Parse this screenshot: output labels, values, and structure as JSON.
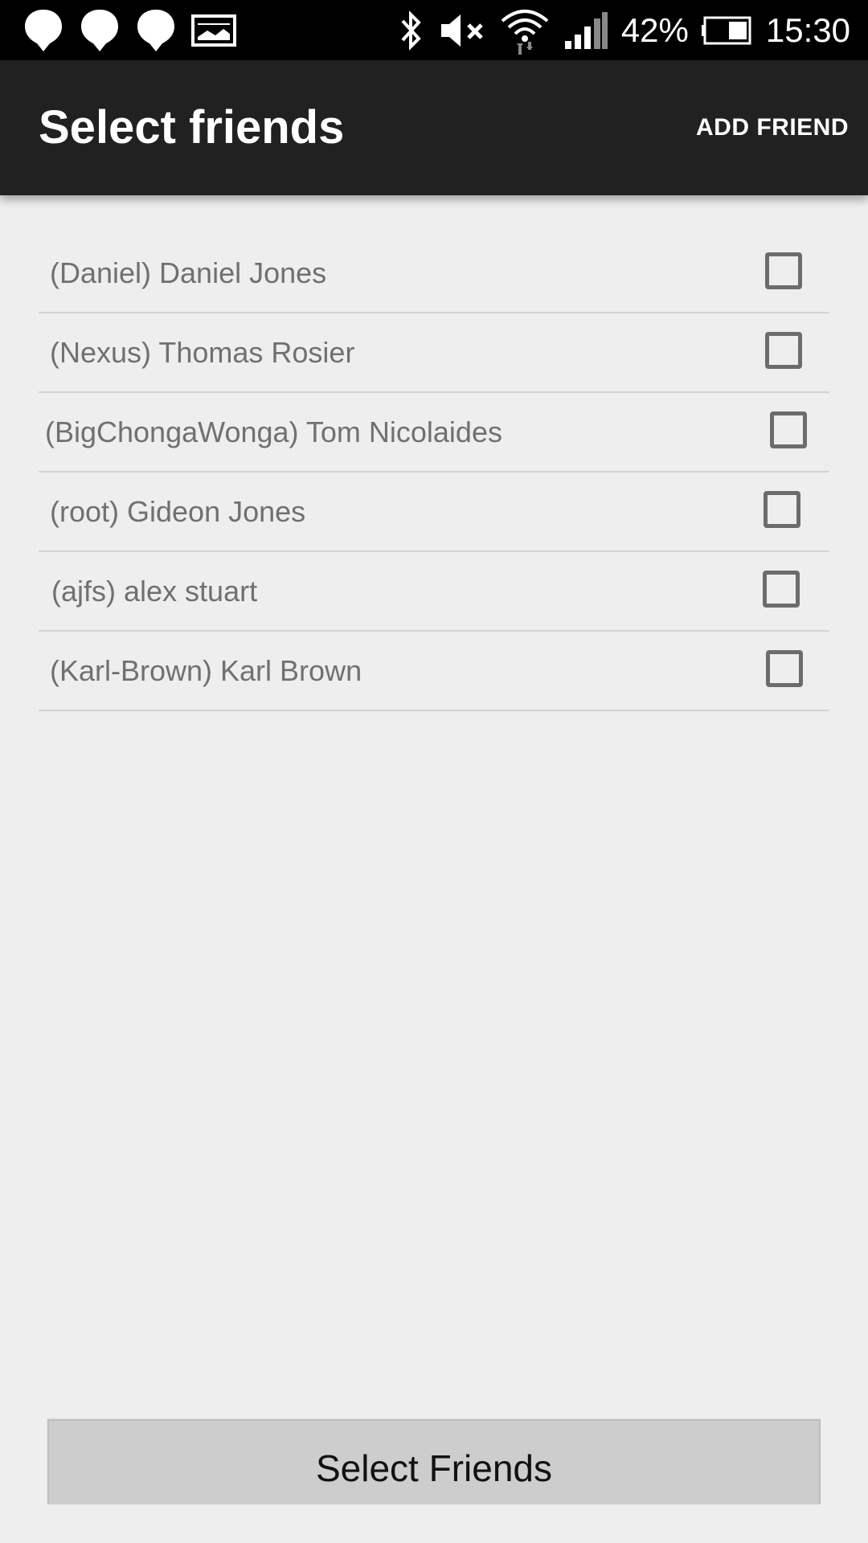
{
  "status_bar": {
    "icons_left": [
      "location-pin-icon",
      "location-pin-icon",
      "location-pin-icon",
      "image-icon"
    ],
    "icons_right": [
      "bluetooth-icon",
      "volume-muted-icon",
      "wifi-icon",
      "signal-icon",
      "battery-icon"
    ],
    "battery": "42%",
    "time": "15:30"
  },
  "app_bar": {
    "title": "Select friends",
    "action": "ADD FRIEND"
  },
  "friends": [
    {
      "label": "(Daniel) Daniel Jones",
      "checked": false
    },
    {
      "label": "(Nexus) Thomas Rosier",
      "checked": false
    },
    {
      "label": "(BigChongaWonga) Tom Nicolaides",
      "checked": false
    },
    {
      "label": "(root) Gideon Jones",
      "checked": false
    },
    {
      "label": "(ajfs) alex stuart",
      "checked": false
    },
    {
      "label": "(Karl-Brown) Karl Brown",
      "checked": false
    }
  ],
  "bottom_button": "Select Friends",
  "colors": {
    "status_bar_bg": "#000000",
    "app_bar_bg": "#212121",
    "page_bg": "#eeeeee",
    "button_bg": "#cdcdcd"
  }
}
